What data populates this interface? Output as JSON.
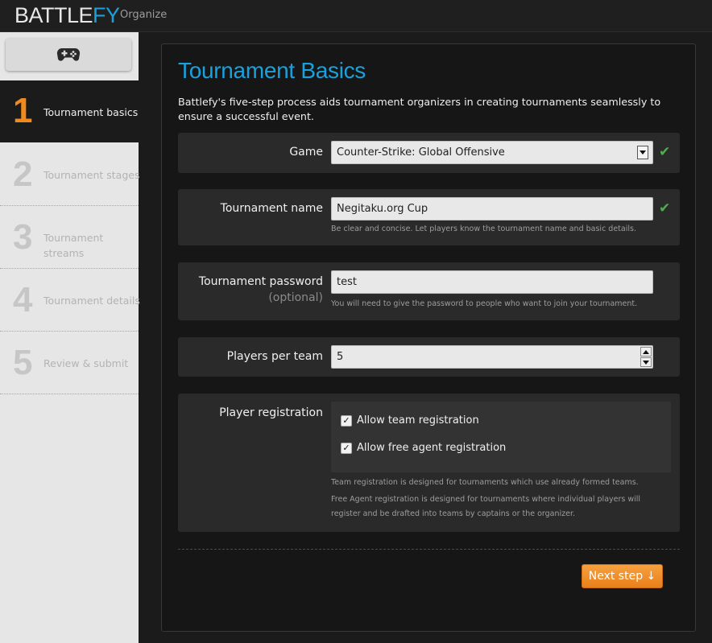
{
  "header": {
    "logo_part1": "BATTLE",
    "logo_part2": "FY",
    "nav_organize": "Organize"
  },
  "sidebar": {
    "gamepad_icon": "gamepad-icon",
    "steps": [
      {
        "number": "1",
        "label": "Tournament basics",
        "active": true
      },
      {
        "number": "2",
        "label": "Tournament stages",
        "active": false
      },
      {
        "number": "3",
        "label_line1": "Tournament",
        "label_line2": "streams",
        "active": false
      },
      {
        "number": "4",
        "label": "Tournament details",
        "active": false
      },
      {
        "number": "5",
        "label": "Review & submit",
        "active": false
      }
    ]
  },
  "main": {
    "title": "Tournament Basics",
    "intro": "Battlefy's five-step process aids tournament organizers in creating tournaments seamlessly to ensure a successful event.",
    "game": {
      "label": "Game",
      "value": "Counter-Strike: Global Offensive",
      "valid": true
    },
    "tournament_name": {
      "label": "Tournament name",
      "value": "Negitaku.org Cup",
      "hint": "Be clear and concise. Let players know the tournament name and basic details.",
      "valid": true
    },
    "password": {
      "label": "Tournament password",
      "sublabel": "(optional)",
      "value": "test",
      "hint": "You will need to give the password to people who want to join your tournament."
    },
    "players_per_team": {
      "label": "Players per team",
      "value": "5"
    },
    "registration": {
      "label": "Player registration",
      "options": [
        {
          "label": "Allow team registration",
          "checked": true
        },
        {
          "label": "Allow free agent registration",
          "checked": true
        }
      ],
      "hint1": "Team registration is designed for tournaments which use already formed teams.",
      "hint2": "Free Agent registration is designed for tournaments where individual players will register and be drafted into teams by captains or the organizer."
    },
    "next_button": "Next step ↓"
  },
  "colors": {
    "accent_blue": "#1aa1dc",
    "accent_orange": "#f08a1e",
    "valid_green": "#4bb24b"
  }
}
